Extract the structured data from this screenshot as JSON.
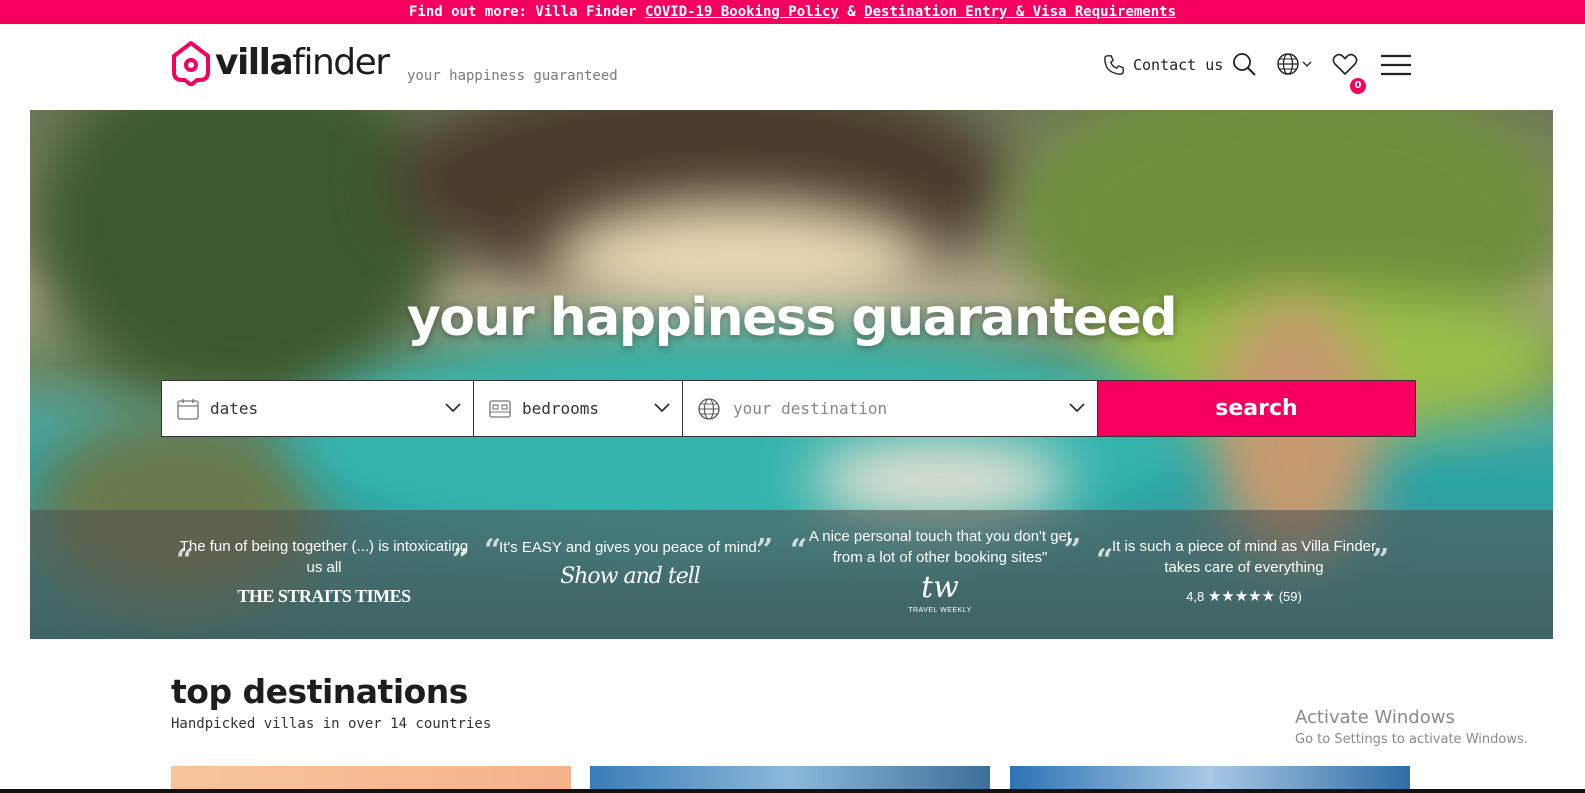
{
  "topbar": {
    "prefix": "Find out more: Villa Finder ",
    "link1": "COVID-19 Booking Policy",
    "amp": " & ",
    "link2": "Destination Entry & Visa Requirements"
  },
  "header": {
    "logo_a": "villa",
    "logo_b": "finder",
    "tagline": "your happiness guaranteed",
    "contact_label": "Contact us",
    "favorites_count": "0",
    "icons": [
      "phone-icon",
      "search-icon",
      "globe-icon",
      "heart-icon",
      "menu-icon"
    ]
  },
  "hero": {
    "title": "your happiness guaranteed",
    "search": {
      "dates_label": "dates",
      "bedrooms_label": "bedrooms",
      "destination_placeholder": "your destination",
      "button_label": "search"
    },
    "reviews": [
      {
        "quote": "The fun of being together (...) is intoxicating us all",
        "source": "THE STRAITS TIMES"
      },
      {
        "quote": "It's EASY and gives you peace of mind.",
        "source": "Show and tell"
      },
      {
        "quote": "A nice personal touch that you don't get from a lot of other booking sites\"",
        "source": "tw",
        "source_sub": "TRAVEL WEEKLY"
      },
      {
        "quote": "It is such a piece of mind as Villa Finder takes care of everything",
        "rating": "4,8",
        "stars": "★★★★★",
        "count": "(59)"
      }
    ]
  },
  "top_destinations": {
    "title": "top destinations",
    "subtitle": "Handpicked villas in over 14 countries"
  },
  "os_watermark": {
    "line1": "Activate Windows",
    "line2": "Go to Settings to activate Windows."
  },
  "colors": {
    "brand": "#f5005f",
    "text": "#1d1d1d"
  }
}
